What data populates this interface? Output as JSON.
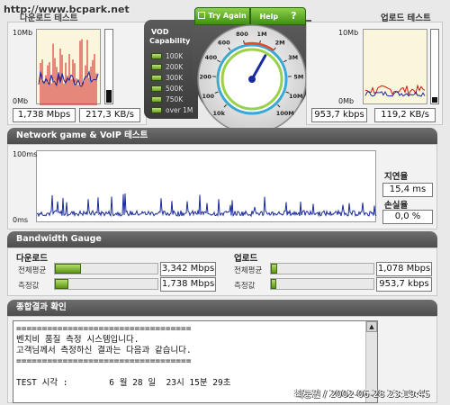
{
  "watermark_url": "http://www.bcpark.net",
  "download": {
    "title": "다운로드 테스트",
    "scale_top": "10Mb",
    "scale_bottom": "0Mb",
    "speed_mbps": "1,738 Mbps",
    "speed_kbs": "217,3 KB/s"
  },
  "upload": {
    "title": "업로드 테스트",
    "scale_top": "10Mb",
    "scale_bottom": "0Mb",
    "speed_kbps": "953,7 kbps",
    "speed_kbs": "119,2 KB/s"
  },
  "controls": {
    "try_again": "Try Again",
    "help": "Help",
    "help_glyph": "?"
  },
  "vod": {
    "title_line1": "VOD",
    "title_line2": "Capability",
    "levels": [
      "100K",
      "200K",
      "300K",
      "500K",
      "750K",
      "over 1M"
    ]
  },
  "gauge": {
    "labels": [
      "10k",
      "100",
      "200",
      "400",
      "600",
      "800",
      "1M",
      "2M",
      "3M",
      "5M",
      "10M",
      "100M"
    ],
    "needle_value_kbps": 1738
  },
  "network": {
    "header": "Network game & VoIP 테스트",
    "scale_top": "100ms",
    "scale_bottom": "0ms",
    "latency_label": "지연율",
    "latency_value": "15,4 ms",
    "loss_label": "손실율",
    "loss_value": "0,0 %"
  },
  "bandwidth": {
    "header": "Bandwidth Gauge",
    "download": {
      "title": "다운로드",
      "avg_label": "전체평균",
      "avg_value": "3,342 Mbps",
      "avg_fraction": 0.25,
      "measured_label": "측정값",
      "measured_value": "1,738 Mbps",
      "measured_fraction": 0.13
    },
    "upload": {
      "title": "업로드",
      "avg_label": "전체평균",
      "avg_value": "1,078 Mbps",
      "avg_fraction": 0.06,
      "measured_label": "측정값",
      "measured_value": "953,7 kbps",
      "measured_fraction": 0.05
    }
  },
  "result": {
    "header": "종합결과 확인",
    "text": "==================================\n벤치비 품질 측정 시스템입니다.\n고객님께서 측정하신 결과는 다음과 같습니다.\n==================================\n\nTEST 시각 :        6 월 28 일  23시 15분 29초"
  },
  "signature": "최둥원 / 2002-06-28 23:19:45",
  "colors": {
    "accent_green": "#6cae24",
    "graph_red": "#d01818",
    "graph_blue": "#1a2a9c",
    "graph_yellow_bg": "#faf6dc"
  }
}
